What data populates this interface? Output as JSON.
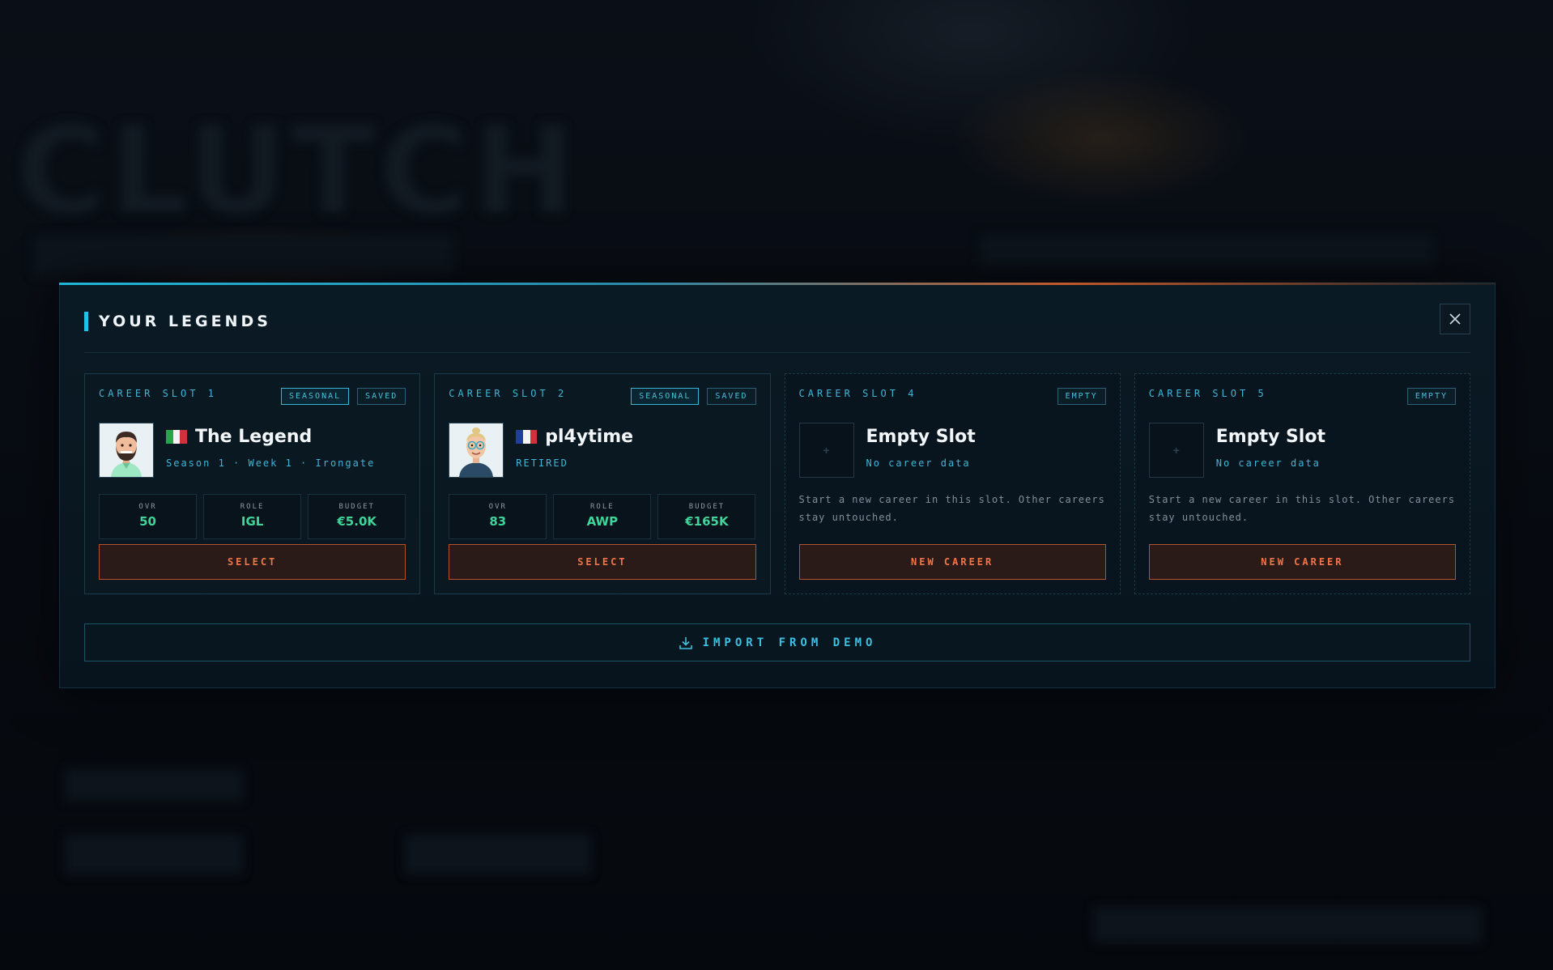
{
  "background": {
    "title": "CLUTCH"
  },
  "modal": {
    "title": "YOUR LEGENDS",
    "close_icon": "close-icon"
  },
  "slots": [
    {
      "label": "CAREER SLOT 1",
      "tags": [
        "SEASONAL",
        "SAVED"
      ],
      "name": "The Legend",
      "flag": "italy",
      "subline": "Season 1 · Week 1 · Irongate",
      "stats": [
        {
          "label": "OVR",
          "value": "50"
        },
        {
          "label": "ROLE",
          "value": "IGL"
        },
        {
          "label": "BUDGET",
          "value": "€5.0K"
        }
      ],
      "action": "SELECT"
    },
    {
      "label": "CAREER SLOT 2",
      "tags": [
        "SEASONAL",
        "SAVED"
      ],
      "name": "pl4ytime",
      "flag": "france",
      "subline": "RETIRED",
      "stats": [
        {
          "label": "OVR",
          "value": "83"
        },
        {
          "label": "ROLE",
          "value": "AWP"
        },
        {
          "label": "BUDGET",
          "value": "€165K"
        }
      ],
      "action": "SELECT"
    },
    {
      "label": "CAREER SLOT 4",
      "tags": [
        "EMPTY"
      ],
      "name": "Empty Slot",
      "subline": "No career data",
      "description": "Start a new career in this slot. Other careers stay untouched.",
      "action": "NEW CAREER"
    },
    {
      "label": "CAREER SLOT 5",
      "tags": [
        "EMPTY"
      ],
      "name": "Empty Slot",
      "subline": "No career data",
      "description": "Start a new career in this slot. Other careers stay untouched.",
      "action": "NEW CAREER"
    }
  ],
  "import": {
    "label": "IMPORT FROM DEMO",
    "icon": "download-icon"
  },
  "colors": {
    "accent": "#1fc3e8",
    "action": "#f07648",
    "stat_value": "#3fd49a"
  }
}
